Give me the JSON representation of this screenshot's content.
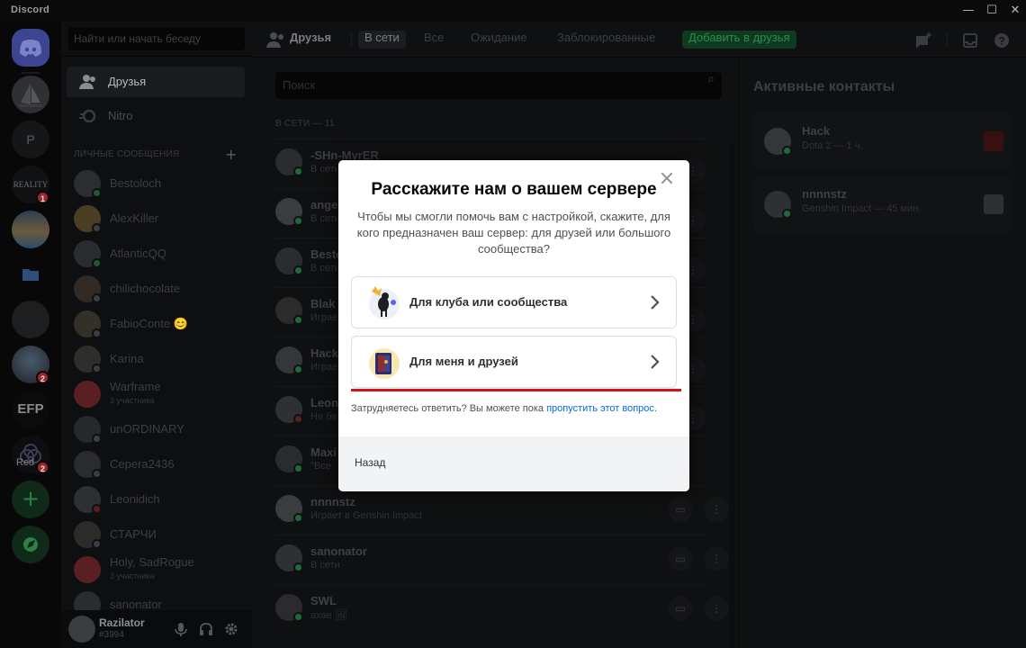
{
  "window": {
    "app_name": "Discord",
    "minimize": "—",
    "maximize": "☐",
    "close": "✕"
  },
  "rail": {
    "servers": [
      {
        "name": "Reality server",
        "label": "REALITY",
        "badge": "1"
      },
      {
        "name": "P server",
        "label": "P"
      },
      {
        "name": "avatar server 1",
        "badge": "2"
      },
      {
        "name": "EFP server",
        "label": "EFP"
      },
      {
        "name": "Red server",
        "label": "Red",
        "badge": "2"
      }
    ]
  },
  "sidebar": {
    "search_placeholder": "Найти или начать беседу",
    "nav": [
      {
        "label": "Друзья"
      },
      {
        "label": "Nitro"
      }
    ],
    "dm_header": "ЛИЧНЫЕ СООБЩЕНИЯ",
    "dm_add": "+",
    "dms": [
      {
        "name": "Bestoloch",
        "status": "#3ba55c"
      },
      {
        "name": "AlexKiller",
        "status": "#747f8d"
      },
      {
        "name": "AtlanticQQ",
        "status": "#3ba55c"
      },
      {
        "name": "chilichocolate",
        "status": "#747f8d"
      },
      {
        "name": "FabioConte 😊",
        "status": "#747f8d"
      },
      {
        "name": "Karina",
        "status": "#747f8d"
      },
      {
        "name": "Warframe",
        "sub": "3 участника",
        "group": true
      },
      {
        "name": "unORDINARY",
        "status": "#747f8d"
      },
      {
        "name": "Cepera2436",
        "status": "#747f8d"
      },
      {
        "name": "Leonidich",
        "status": "#ed4245"
      },
      {
        "name": "СТАРЧИ",
        "status": "#747f8d"
      },
      {
        "name": "Holy, SadRogue",
        "sub": "3 участника",
        "group": true
      },
      {
        "name": "sanonator",
        "status": "#747f8d"
      }
    ]
  },
  "user": {
    "name": "Razilator",
    "tag": "#3994"
  },
  "header": {
    "title": "Друзья",
    "tabs": [
      "В сети",
      "Все",
      "Ожидание",
      "Заблокированные"
    ],
    "add_friend": "Добавить в друзья"
  },
  "friends": {
    "search_placeholder": "Поиск",
    "count_label": "В СЕТИ — 11",
    "rows": [
      {
        "name": "-SHn-MyrER",
        "sub": "В сети",
        "status": "#3ba55c"
      },
      {
        "name": "angel",
        "sub": "В сети",
        "status": "#3ba55c"
      },
      {
        "name": "Bestoloch",
        "sub": "В сети",
        "status": "#3ba55c"
      },
      {
        "name": "Blak",
        "sub": "Играет",
        "status": "#3ba55c"
      },
      {
        "name": "Hack",
        "sub": "Играет",
        "status": "#3ba55c"
      },
      {
        "name": "Leon",
        "sub": "Не бе",
        "status": "#ed4245"
      },
      {
        "name": "Maxi",
        "sub": "\"Все",
        "status": "#3ba55c"
      },
      {
        "name": "nnnnstz",
        "sub": "Играет в Genshin Impact",
        "status": "#3ba55c"
      },
      {
        "name": "sanonator",
        "sub": "В сети",
        "status": "#3ba55c"
      },
      {
        "name": "SWL",
        "sub": "ахае 🖼",
        "status": "#3ba55c"
      }
    ]
  },
  "active": {
    "title": "Активные контакты",
    "cards": [
      {
        "name": "Hack",
        "sub": "Dota 2 — 1 ч."
      },
      {
        "name": "nnnnstz",
        "sub": "Genshin Impact — 45 мин."
      }
    ]
  },
  "modal": {
    "title": "Расскажите нам о вашем сервере",
    "description": "Чтобы мы смогли помочь вам с настройкой, скажите, для кого предназначен ваш сервер: для друзей или большого сообщества?",
    "options": [
      {
        "label": "Для клуба или сообщества"
      },
      {
        "label": "Для меня и друзей"
      }
    ],
    "help_text": "Затрудняетесь ответить? Вы можете пока ",
    "help_link": "пропустить этот вопрос",
    "help_end": ".",
    "back": "Назад",
    "close": "×"
  },
  "colors": {
    "accent": "#5865f2",
    "link": "#006ce7",
    "underline_annotation": "#d0161b",
    "online": "#3ba55c",
    "dnd": "#ed4245"
  }
}
